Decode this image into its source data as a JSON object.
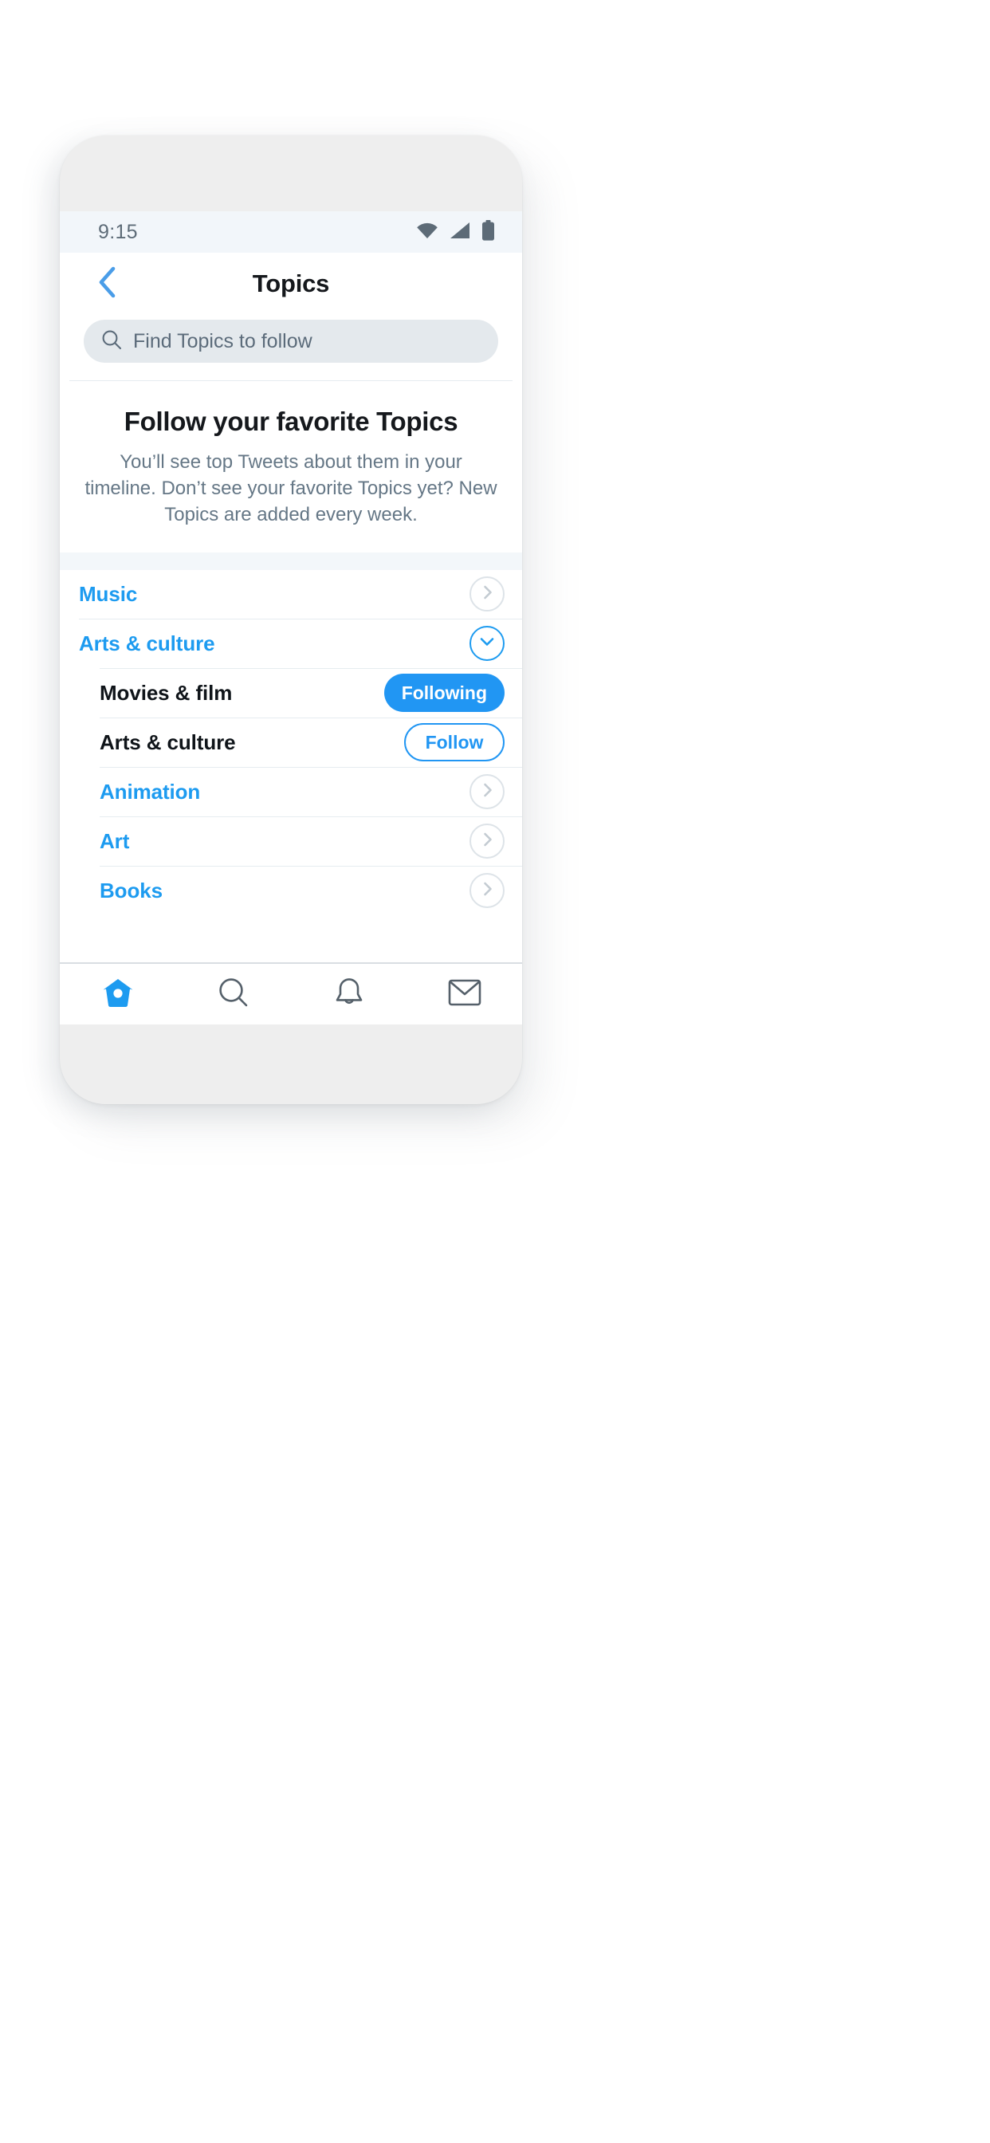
{
  "colors": {
    "brand_blue": "#1d9bf0",
    "button_blue": "#2196f3",
    "text_dark": "#15181c",
    "text_muted": "#657786",
    "search_bg": "#e4e9ed",
    "status_bg": "#f2f6fa",
    "separator": "#e6ecf0"
  },
  "status_bar": {
    "time": "9:15",
    "icons": [
      "wifi-icon",
      "cellular-signal-icon",
      "battery-icon"
    ]
  },
  "header": {
    "back_icon": "chevron-left-icon",
    "title": "Topics"
  },
  "search": {
    "icon": "search-icon",
    "placeholder": "Find Topics to follow",
    "value": ""
  },
  "intro": {
    "title": "Follow your favorite Topics",
    "body": "You’ll see top Tweets about them in your timeline. Don’t see your favorite Topics yet? New Topics are added every week."
  },
  "topics": [
    {
      "label": "Music",
      "style": "blue",
      "indent": false,
      "control": "chevron-right-circle",
      "control_label": "expand"
    },
    {
      "label": "Arts & culture",
      "style": "blue",
      "indent": false,
      "control": "chevron-down-circle-active",
      "control_label": "collapse"
    },
    {
      "label": "Movies & film",
      "style": "dark",
      "indent": true,
      "control": "button-following",
      "control_label": "Following"
    },
    {
      "label": "Arts & culture",
      "style": "dark",
      "indent": true,
      "control": "button-follow",
      "control_label": "Follow"
    },
    {
      "label": "Animation",
      "style": "blue",
      "indent": true,
      "control": "chevron-right-circle",
      "control_label": "expand"
    },
    {
      "label": "Art",
      "style": "blue",
      "indent": true,
      "control": "chevron-right-circle",
      "control_label": "expand"
    },
    {
      "label": "Books",
      "style": "blue",
      "indent": true,
      "control": "chevron-right-circle",
      "control_label": "expand"
    }
  ],
  "bottom_nav": [
    {
      "name": "home-icon",
      "active": true
    },
    {
      "name": "search-icon",
      "active": false
    },
    {
      "name": "bell-icon",
      "active": false
    },
    {
      "name": "envelope-icon",
      "active": false
    }
  ]
}
